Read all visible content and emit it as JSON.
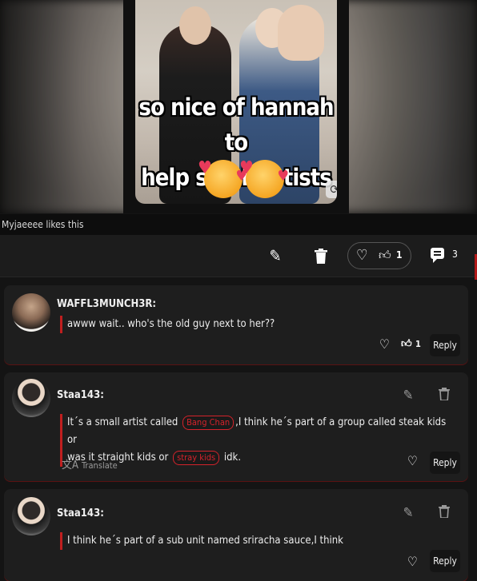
{
  "post": {
    "caption_line1": "so nice of hannah to",
    "caption_line2": "help small artists",
    "emoji_icon": "smiling-face-with-hearts",
    "likes_text": "Myjaeeee likes this"
  },
  "actions": {
    "edit_icon": "pencil-icon",
    "delete_icon": "trash-icon",
    "like_count": "1",
    "comment_count": "3"
  },
  "comments": [
    {
      "username": "WAFFL3MUNCH3R:",
      "text": "awww wait.. who's the old guy next to her??",
      "likes": "1",
      "reply_label": "Reply"
    },
    {
      "username": "Staa143:",
      "text_part1": "It´s a small artist called",
      "tag1": "Bang Chan",
      "text_part2": ",I think he´s part of a group called steak kids or",
      "text_part3": "was it straight kids or",
      "tag2": "stray kids",
      "text_part4": "idk.",
      "translate_label": "Translate",
      "reply_label": "Reply"
    },
    {
      "username": "Staa143:",
      "text": "I think he´s part of a sub unit named sriracha sauce,I think",
      "reply_label": "Reply"
    }
  ],
  "colors": {
    "accent_red": "#c01f1f",
    "background": "#141414",
    "card": "#1e1e1e"
  }
}
